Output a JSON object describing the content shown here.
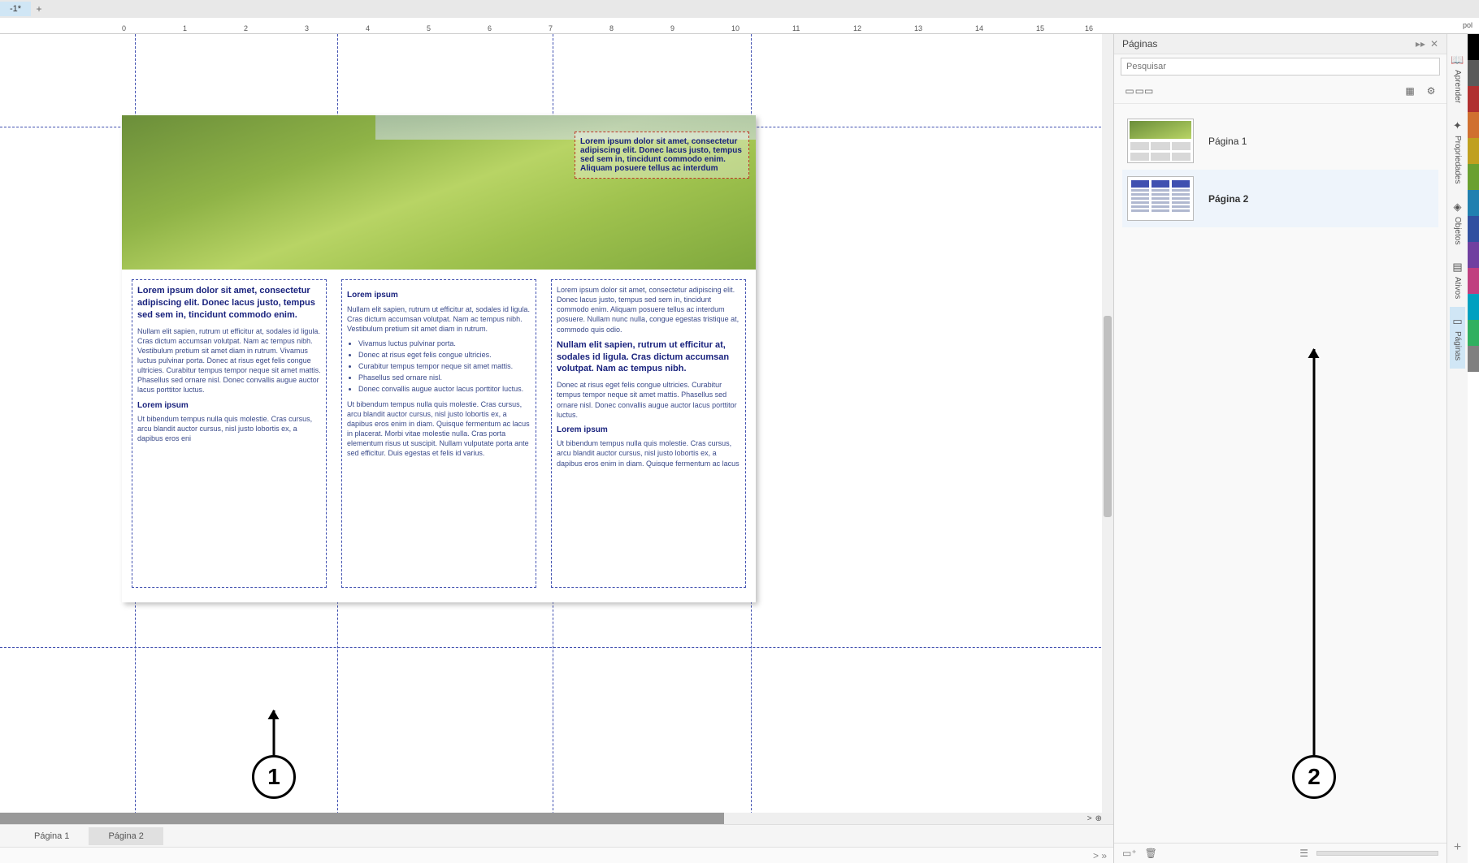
{
  "doc_tab": "-1*",
  "ruler_unit": "pol",
  "ruler_marks": [
    "0",
    "1",
    "2",
    "3",
    "4",
    "5",
    "6",
    "7",
    "8",
    "9",
    "10",
    "11",
    "12",
    "13",
    "14",
    "15",
    "16"
  ],
  "page_tabs": {
    "tab1": "Página 1",
    "tab2": "Página 2"
  },
  "canvas": {
    "img_caption": "Lorem ipsum dolor sit amet, consectetur adipiscing elit. Donec lacus justo, tempus sed sem in, tincidunt commodo enim. Aliquam posuere tellus ac interdum",
    "col1": {
      "h1": "Lorem ipsum dolor sit amet, consectetur adipiscing elit. Donec lacus justo, tempus sed sem in, tincidunt commodo enim.",
      "p1": "Nullam elit sapien, rutrum ut efficitur at, sodales id ligula. Cras dictum accumsan volutpat. Nam ac tempus nibh. Vestibulum pretium sit amet diam in rutrum. Vivamus luctus pulvinar porta. Donec at risus eget felis congue ultricies. Curabitur tempus tempor neque sit amet mattis. Phasellus sed ornare nisl. Donec convallis augue auctor lacus porttitor luctus.",
      "h2": "Lorem ipsum",
      "p2": "Ut bibendum tempus nulla quis molestie. Cras cursus, arcu blandit auctor cursus, nisl justo lobortis ex, a dapibus eros eni"
    },
    "col2": {
      "h1": "Lorem ipsum",
      "p1": "Nullam elit sapien, rutrum ut efficitur at, sodales id ligula. Cras dictum accumsan volutpat. Nam ac tempus nibh. Vestibulum pretium sit amet diam in rutrum.",
      "li1": "Vivamus luctus pulvinar porta.",
      "li2": "Donec at risus eget felis congue ultricies.",
      "li3": "Curabitur tempus tempor neque sit amet mattis.",
      "li4": "Phasellus sed ornare nisl.",
      "li5": "Donec convallis augue auctor lacus porttitor luctus.",
      "p2": "Ut bibendum tempus nulla quis molestie. Cras cursus, arcu blandit auctor cursus, nisl justo lobortis ex, a dapibus eros enim in diam. Quisque fermentum ac lacus in placerat. Morbi vitae molestie nulla. Cras porta elementum risus ut suscipit. Nullam vulputate porta ante sed efficitur. Duis egestas et felis id varius."
    },
    "col3": {
      "p1": "Lorem ipsum dolor sit amet, consectetur adipiscing elit. Donec lacus justo, tempus sed sem in, tincidunt commodo enim. Aliquam posuere tellus ac interdum posuere. Nullam nunc nulla, congue egestas tristique at, commodo quis odio.",
      "h1": "Nullam elit sapien, rutrum ut efficitur at, sodales id ligula. Cras dictum accumsan volutpat. Nam ac tempus nibh.",
      "p2": "Donec at risus eget felis congue ultricies. Curabitur tempus tempor neque sit amet mattis. Phasellus sed ornare nisl. Donec convallis augue auctor lacus porttitor luctus.",
      "h2": "Lorem ipsum",
      "p3": "Ut bibendum tempus nulla quis molestie. Cras cursus, arcu blandit auctor cursus, nisl justo lobortis ex, a dapibus eros enim in diam. Quisque fermentum ac lacus"
    }
  },
  "panel": {
    "title": "Páginas",
    "search_placeholder": "Pesquisar",
    "items": {
      "p1": "Página 1",
      "p2": "Página 2"
    }
  },
  "side_tabs": {
    "aprender": "Aprender",
    "propriedades": "Propriedades",
    "objetos": "Objetos",
    "ativos": "Ativos",
    "paginas": "Páginas"
  },
  "callouts": {
    "c1": "1",
    "c2": "2"
  },
  "colors": [
    "#000000",
    "#5a5a5a",
    "#b03030",
    "#d07030",
    "#c0a020",
    "#6aa030",
    "#2080b0",
    "#3050a0",
    "#7040a0",
    "#c04080",
    "#00a0c0",
    "#30b060",
    "#808080",
    "#d0c0a0"
  ],
  "icons": {
    "chev": ">",
    "more": "»"
  }
}
